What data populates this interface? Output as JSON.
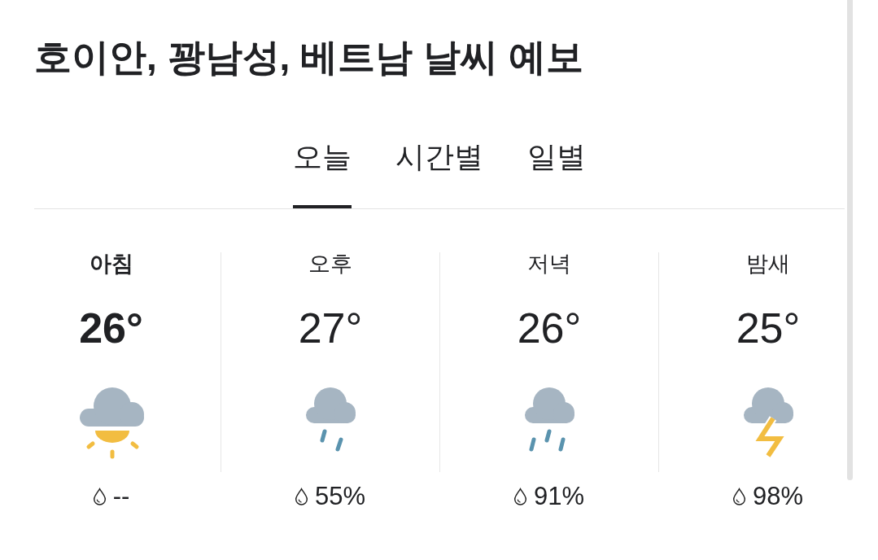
{
  "title": "호이안, 꽝남성, 베트남 날씨 예보",
  "tabs": [
    {
      "label": "오늘",
      "selected": true
    },
    {
      "label": "시간별",
      "selected": false
    },
    {
      "label": "일별",
      "selected": false
    }
  ],
  "periods": [
    {
      "label": "아침",
      "current": true,
      "temperature": "26°",
      "kind": "partly-sunny",
      "precipitation": "--"
    },
    {
      "label": "오후",
      "current": false,
      "temperature": "27°",
      "kind": "light-rain",
      "precipitation": "55%"
    },
    {
      "label": "저녁",
      "current": false,
      "temperature": "26°",
      "kind": "rain",
      "precipitation": "91%"
    },
    {
      "label": "밤새",
      "current": false,
      "temperature": "25°",
      "kind": "thunderstorm",
      "precipitation": "98%"
    }
  ]
}
